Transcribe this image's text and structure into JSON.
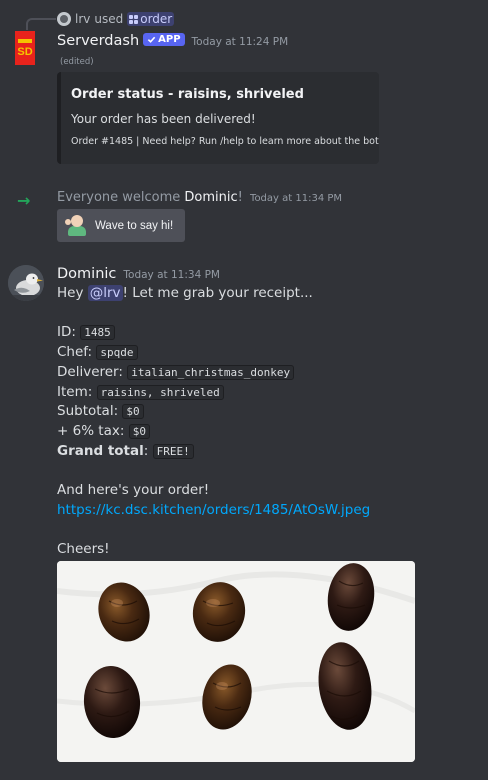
{
  "reply": {
    "user": "lrv",
    "used_text": "used",
    "command": "order"
  },
  "bot_message": {
    "author": "Serverdash",
    "badge": "APP",
    "timestamp": "Today at 11:24 PM",
    "edited": "(edited)",
    "avatar_text": "SD",
    "embed": {
      "title": "Order status - raisins, shriveled",
      "description": "Your order has been delivered!",
      "footer": "Order #1485 | Need help? Run /help to learn more about the bot"
    }
  },
  "welcome": {
    "prefix": "Everyone welcome",
    "user": "Dominic",
    "suffix": "!",
    "timestamp": "Today at 11:34 PM",
    "wave_button": "Wave to say hi!"
  },
  "user_message": {
    "author": "Dominic",
    "timestamp": "Today at 11:34 PM",
    "greeting_prefix": "Hey",
    "mention": "@lrv",
    "greeting_suffix": "! Let me grab your receipt...",
    "fields": [
      {
        "label": "ID:",
        "value": "1485",
        "bold": false
      },
      {
        "label": "Chef:",
        "value": "spqde",
        "bold": false
      },
      {
        "label": "Deliverer:",
        "value": "italian_christmas_donkey",
        "bold": false
      },
      {
        "label": "Item:",
        "value": "raisins, shriveled",
        "bold": false
      },
      {
        "label": "Subtotal:",
        "value": "$0",
        "bold": false
      },
      {
        "label": "+ 6% tax:",
        "value": "$0",
        "bold": false
      },
      {
        "label": "Grand total",
        "value": "FREE!",
        "bold": true
      }
    ],
    "order_line": "And here's your order!",
    "link": "https://kc.dsc.kitchen/orders/1485/AtOsW.jpeg",
    "closing": "Cheers!"
  },
  "colors": {
    "background": "#313338",
    "embed_bg": "#2b2d31",
    "blurple": "#5865f2",
    "link": "#00a8fc",
    "join_arrow": "#23a55a"
  },
  "icons": [
    "user-avatar-icon",
    "command-icon",
    "verified-check-icon",
    "join-arrow-icon",
    "wave-sticker-icon"
  ]
}
